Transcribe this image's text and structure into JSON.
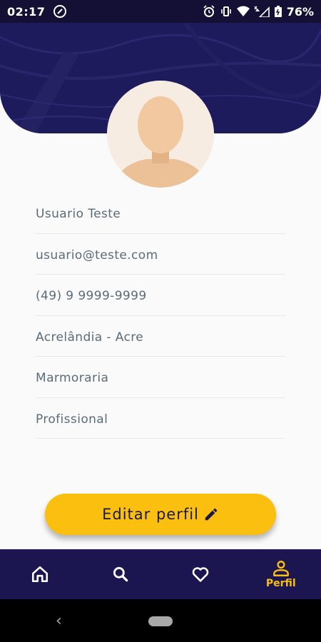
{
  "status_bar": {
    "time": "02:17",
    "battery": "76%"
  },
  "profile": {
    "fields": [
      {
        "key": "name",
        "value": "Usuario Teste"
      },
      {
        "key": "email",
        "value": "usuario@teste.com"
      },
      {
        "key": "phone",
        "value": "(49) 9 9999-9999"
      },
      {
        "key": "location",
        "value": "Acrelândia - Acre"
      },
      {
        "key": "category",
        "value": "Marmoraria"
      },
      {
        "key": "type",
        "value": "Profissional"
      }
    ],
    "edit_button_label": "Editar perfil"
  },
  "bottom_nav": {
    "items": [
      {
        "id": "home",
        "icon": "home-icon",
        "label": ""
      },
      {
        "id": "search",
        "icon": "search-icon",
        "label": ""
      },
      {
        "id": "favorites",
        "icon": "heart-icon",
        "label": ""
      },
      {
        "id": "profile",
        "icon": "person-icon",
        "label": "Perfil",
        "active": true
      }
    ]
  },
  "colors": {
    "primary": "#1b1650",
    "accent": "#fbbf10",
    "text": "#5b6b7b"
  }
}
